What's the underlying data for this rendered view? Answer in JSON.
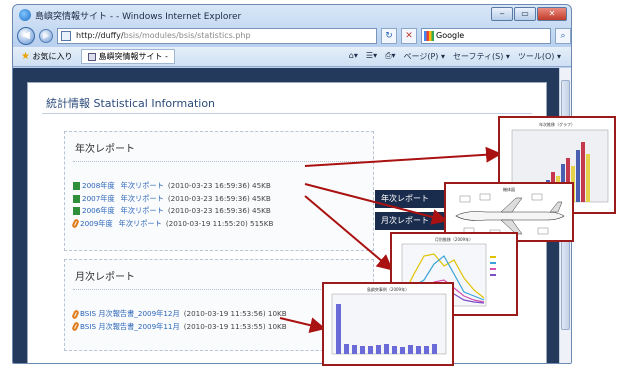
{
  "browser": {
    "window_title": "島嶼突情報サイト - - Windows Internet Explorer",
    "window_controls": [
      "‒",
      "▭",
      "✕"
    ],
    "address_host": "http://duffy/",
    "address_path": "bsis/modules/bsis/statistics.php",
    "search_engine": "Google",
    "favorites_label": "お気に入り",
    "tab_title": "島嶼突情報サイト -",
    "tools": [
      "ページ(P) ▾",
      "セーフティ(S) ▾",
      "ツール(O) ▾"
    ]
  },
  "page": {
    "title": "統計情報  Statistical Information",
    "annual": {
      "heading": "年次レポート",
      "items": [
        {
          "icon": "spreadsheet-icon",
          "link": "2008年度",
          "label": "年次リポート",
          "meta": "(2010-03-23 16:59:36) 45KB"
        },
        {
          "icon": "spreadsheet-icon",
          "link": "2007年度",
          "label": "年次リポート",
          "meta": "(2010-03-23 16:59:36) 45KB"
        },
        {
          "icon": "spreadsheet-icon",
          "link": "2006年度",
          "label": "年次リポート",
          "meta": "(2010-03-23 16:59:36) 45KB"
        },
        {
          "icon": "pdf-icon",
          "link": "2009年度",
          "label": "年次リポート",
          "meta": "(2010-03-19 11:55:20) 515KB"
        }
      ]
    },
    "monthly": {
      "heading": "月次レポート",
      "items": [
        {
          "icon": "pdf-icon",
          "link": "BSIS 月次報告書_2009年12月",
          "meta": "(2010-03-19 11:53:56) 10KB"
        },
        {
          "icon": "pdf-icon",
          "link": "BSIS 月次報告書_2009年11月",
          "meta": "(2010-03-19 11:53:55) 10KB"
        }
      ]
    },
    "side_nav": [
      "年次レポート",
      "月次レポート"
    ]
  },
  "thumbnails": [
    {
      "id": "thumb-bar-annual",
      "caption": "年次推移（グラフ）"
    },
    {
      "id": "thumb-aircraft-diagram",
      "caption": "機体図"
    },
    {
      "id": "thumb-line-monthly",
      "caption": "月別推移（2009年）"
    },
    {
      "id": "thumb-bar-monthly",
      "caption": "島嶼突事例（2009年）"
    }
  ],
  "colors": {
    "accent": "#9b1b1b",
    "nav_dark": "#1a2c4d",
    "link": "#2a66b8"
  }
}
